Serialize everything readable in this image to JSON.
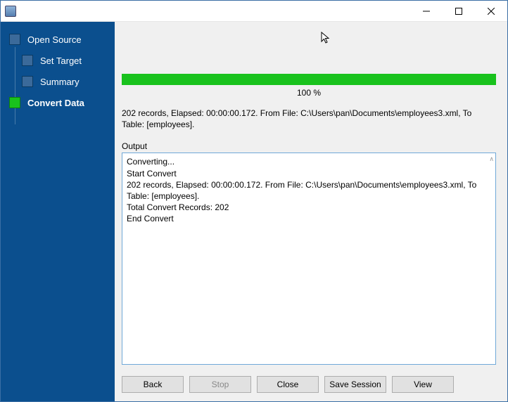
{
  "window": {
    "title": ""
  },
  "sidebar": {
    "items": [
      {
        "label": "Open Source"
      },
      {
        "label": "Set Target"
      },
      {
        "label": "Summary"
      },
      {
        "label": "Convert Data"
      }
    ]
  },
  "progress": {
    "percent_label": "100 %"
  },
  "status": "202 records,   Elapsed: 00:00:00.172.    From File: C:\\Users\\pan\\Documents\\employees3.xml,    To Table: [employees].",
  "output": {
    "label": "Output",
    "lines": [
      "Converting...",
      "Start Convert",
      "202 records,   Elapsed: 00:00:00.172.    From File: C:\\Users\\pan\\Documents\\employees3.xml,    To Table: [employees].",
      "Total Convert Records: 202",
      "End Convert"
    ]
  },
  "buttons": {
    "back": "Back",
    "stop": "Stop",
    "close": "Close",
    "save_session": "Save Session",
    "view": "View"
  }
}
